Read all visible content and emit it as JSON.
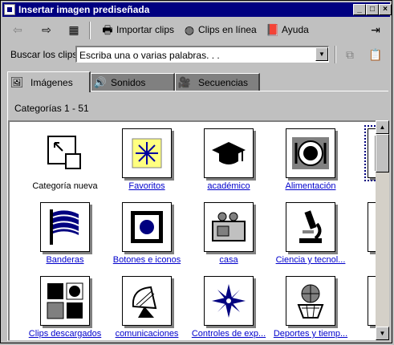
{
  "window": {
    "title": "Insertar imagen prediseñada"
  },
  "toolbar": {
    "back_icon": "back-arrow-icon",
    "forward_icon": "forward-arrow-icon",
    "import_label": "Importar clips",
    "online_label": "Clips en línea",
    "help_label": "Ayuda"
  },
  "search": {
    "label": "Buscar los clips:",
    "value": "Escriba una o varias palabras. . ."
  },
  "tabs": [
    {
      "label": "Imágenes",
      "icon": "images-icon"
    },
    {
      "label": "Sonidos",
      "icon": "sounds-icon"
    },
    {
      "label": "Secuencias",
      "icon": "video-icon"
    }
  ],
  "categories": {
    "count_label": "Categorías 1 - 51"
  },
  "items": [
    {
      "label": "Categoría nueva",
      "icon": "new-category-icon"
    },
    {
      "label": "Favoritos",
      "icon": "favorites-icon"
    },
    {
      "label": "académico",
      "icon": "graduation-cap-icon"
    },
    {
      "label": "Alimentación",
      "icon": "plate-icon"
    },
    {
      "label": "ani",
      "icon": "animals-icon"
    },
    {
      "label": "Banderas",
      "icon": "flag-icon"
    },
    {
      "label": "Botones e iconos",
      "icon": "button-icon"
    },
    {
      "label": "casa",
      "icon": "kitchen-icon"
    },
    {
      "label": "Ciencia y tecnol...",
      "icon": "microscope-icon"
    },
    {
      "label": "c",
      "icon": "stones-icon"
    },
    {
      "label": "Clips descargados",
      "icon": "downloads-icon"
    },
    {
      "label": "comunicaciones",
      "icon": "satellite-dish-icon"
    },
    {
      "label": "Controles de exp...",
      "icon": "compass-icon"
    },
    {
      "label": "Deportes y tiemp...",
      "icon": "basketball-icon"
    },
    {
      "label": "Di",
      "icon": "character-icon"
    }
  ],
  "colors": {
    "title_bar": "#000080",
    "link": "#0000cc",
    "face": "#c0c0c0"
  }
}
